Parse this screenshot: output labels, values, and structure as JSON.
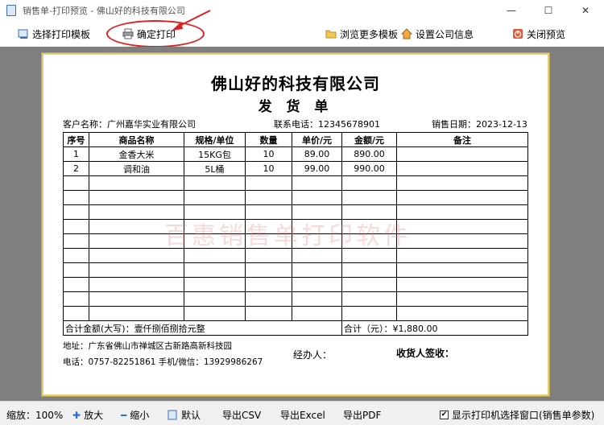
{
  "window": {
    "title": "销售单-打印预览 - 佛山好的科技有限公司",
    "minimize": "—",
    "maximize": "☐",
    "close": "✕"
  },
  "toolbar": {
    "choose_template": "选择打印模板",
    "confirm_print": "确定打印",
    "browse_templates": "浏览更多模板",
    "company_settings": "设置公司信息",
    "close_preview": "关闭预览"
  },
  "doc": {
    "company": "佛山好的科技有限公司",
    "title": "发 货 单",
    "customer": "客户名称：广州嘉华实业有限公司",
    "phone": "联系电话：12345678901",
    "date": "销售日期：2023-12-13",
    "watermark": "百惠销售单打印软件",
    "headers": [
      "序号",
      "商品名称",
      "规格/单位",
      "数量",
      "单价/元",
      "金额/元",
      "备注"
    ],
    "rows": [
      [
        "1",
        "金香大米",
        "15KG包",
        "10",
        "89.00",
        "890.00",
        ""
      ],
      [
        "2",
        "调和油",
        "5L桶",
        "10",
        "99.00",
        "990.00",
        ""
      ]
    ],
    "empty_rows": 10,
    "total_words": "合计金额(大写)：壹仟捌佰捌拾元整",
    "total_amount": "合计（元）：¥1,880.00",
    "address": "地址：广东省佛山市禅城区古新路高新科技园",
    "contact": "电话：0757-82251861 手机/微信：13929986267",
    "handler": "经办人：",
    "receiver": "收货人签收："
  },
  "statusbar": {
    "zoom": "缩放：100%",
    "zoom_in": "放大",
    "zoom_out": "缩小",
    "default": "默认",
    "export_csv": "导出CSV",
    "export_excel": "导出Excel",
    "export_pdf": "导出PDF",
    "show_printer": "显示打印机选择窗口(销售单参数)",
    "show_printer_checked": true
  },
  "colors": {
    "annotation": "#e02020",
    "preview_bg": "#7f7f7f",
    "paper_border": "#e3cf7a"
  }
}
